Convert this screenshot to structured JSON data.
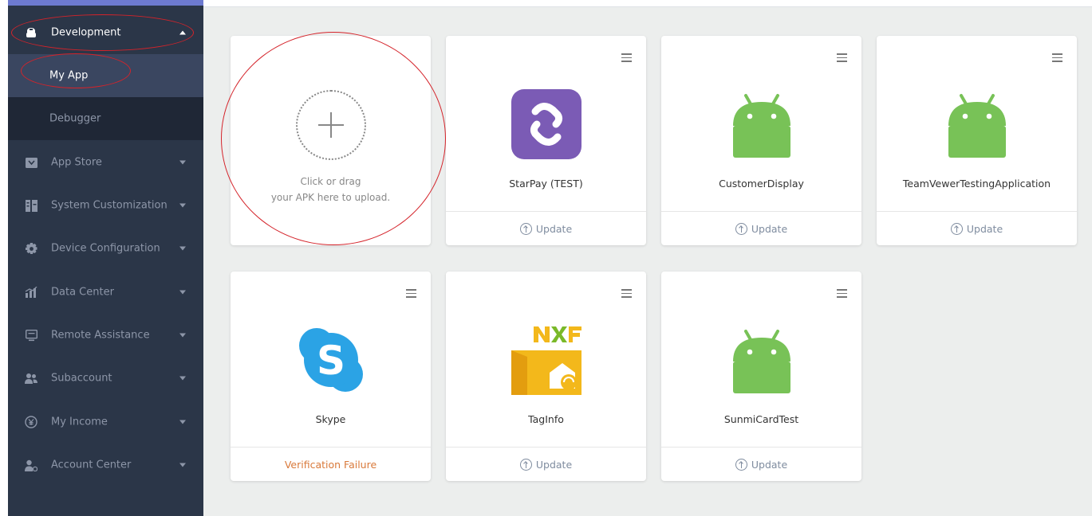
{
  "sidebar": {
    "development": {
      "label": "Development",
      "icon": "wrench-icon"
    },
    "sub_items": [
      {
        "label": "My App",
        "selected": true
      },
      {
        "label": "Debugger",
        "selected": false
      }
    ],
    "items": [
      {
        "label": "App Store",
        "icon": "store-icon"
      },
      {
        "label": "System Customization",
        "icon": "customization-icon"
      },
      {
        "label": "Device Configuration",
        "icon": "gear-icon"
      },
      {
        "label": "Data Center",
        "icon": "chart-icon"
      },
      {
        "label": "Remote Assistance",
        "icon": "monitor-icon"
      },
      {
        "label": "Subaccount",
        "icon": "users-icon"
      },
      {
        "label": "My Income",
        "icon": "income-icon"
      },
      {
        "label": "Account Center",
        "icon": "user-gear-icon"
      }
    ]
  },
  "upload": {
    "line1": "Click or drag",
    "line2": "your APK here to upload."
  },
  "apps": [
    {
      "name": "StarPay (TEST)",
      "icon": "starpay-icon",
      "footer": "Update",
      "status": "update"
    },
    {
      "name": "CustomerDisplay",
      "icon": "android-icon",
      "footer": "Update",
      "status": "update"
    },
    {
      "name": "TeamVewerTestingApplication",
      "icon": "android-icon",
      "footer": "Update",
      "status": "update"
    },
    {
      "name": "Skype",
      "icon": "skype-icon",
      "footer": "Verification Failure",
      "status": "fail"
    },
    {
      "name": "TagInfo",
      "icon": "nxp-taginfo-icon",
      "footer": "Update",
      "status": "update"
    },
    {
      "name": "SunmiCardTest",
      "icon": "android-icon",
      "footer": "Update",
      "status": "update"
    }
  ],
  "colors": {
    "sidebar_bg": "#2b3648",
    "submenu_bg": "#1f2736",
    "selected_bg": "#3a4660",
    "android_green": "#78c257",
    "starpay_purple": "#7b5bb5",
    "skype_blue": "#2ba3e5",
    "fail_orange": "#d9793a",
    "annotation_red": "#d4232a"
  }
}
